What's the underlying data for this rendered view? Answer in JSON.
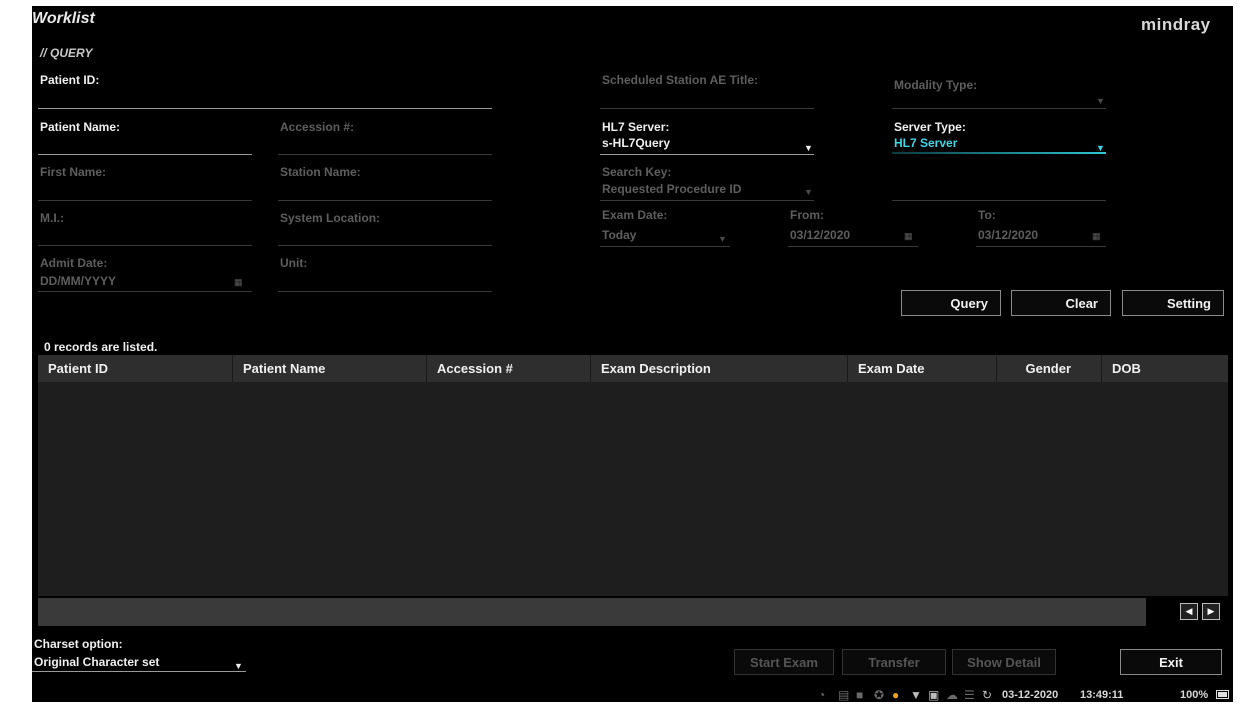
{
  "header": {
    "title": "Worklist",
    "logo": "mindray"
  },
  "query": {
    "section_label": "QUERY",
    "section_icon": "double-slash-icon",
    "patient_id": {
      "label": "Patient ID:",
      "value": ""
    },
    "patient_name": {
      "label": "Patient Name:",
      "value": ""
    },
    "accession": {
      "label": "Accession #:",
      "value": ""
    },
    "first_name": {
      "label": "First Name:",
      "value": ""
    },
    "station_name": {
      "label": "Station Name:",
      "value": ""
    },
    "mi": {
      "label": "M.I.:",
      "value": ""
    },
    "system_location": {
      "label": "System Location:",
      "value": ""
    },
    "admit_date": {
      "label": "Admit Date:",
      "placeholder": "DD/MM/YYYY"
    },
    "unit": {
      "label": "Unit:",
      "value": ""
    },
    "scheduled_station_ae": {
      "label": "Scheduled Station AE Title:",
      "value": ""
    },
    "modality_type": {
      "label": "Modality Type:",
      "value": ""
    },
    "hl7_server": {
      "label": "HL7 Server:",
      "value": "s-HL7Query"
    },
    "server_type": {
      "label": "Server Type:",
      "value": "HL7 Server"
    },
    "search_key": {
      "label": "Search Key:",
      "value": "Requested Procedure ID"
    },
    "exam_date": {
      "label": "Exam Date:",
      "value": "Today"
    },
    "from": {
      "label": "From:",
      "value": "03/12/2020"
    },
    "to": {
      "label": "To:",
      "value": "03/12/2020"
    }
  },
  "buttons": {
    "query": "Query",
    "clear": "Clear",
    "setting": "Setting"
  },
  "records": {
    "count_text": "0 records are listed.",
    "columns": [
      "Patient ID",
      "Patient Name",
      "Accession #",
      "Exam Description",
      "Exam Date",
      "Gender",
      "DOB"
    ],
    "rows": []
  },
  "footer": {
    "charset_label": "Charset option:",
    "charset_value": "Original Character set",
    "start_exam": "Start Exam",
    "transfer": "Transfer",
    "show_detail": "Show Detail",
    "exit": "Exit"
  },
  "status_bar": {
    "icons": [
      "wifi-icon",
      "network-icon",
      "storage-icon",
      "dicom-icon",
      "warning-icon",
      "trash-icon",
      "print-icon",
      "cloud-icon",
      "queue-icon",
      "refresh-icon"
    ],
    "date": "03-12-2020",
    "time": "13:49:11",
    "battery": "100%",
    "battery_icon": "battery-icon",
    "accent_color": "#3fd7e8",
    "warning_color": "#f0a020"
  }
}
